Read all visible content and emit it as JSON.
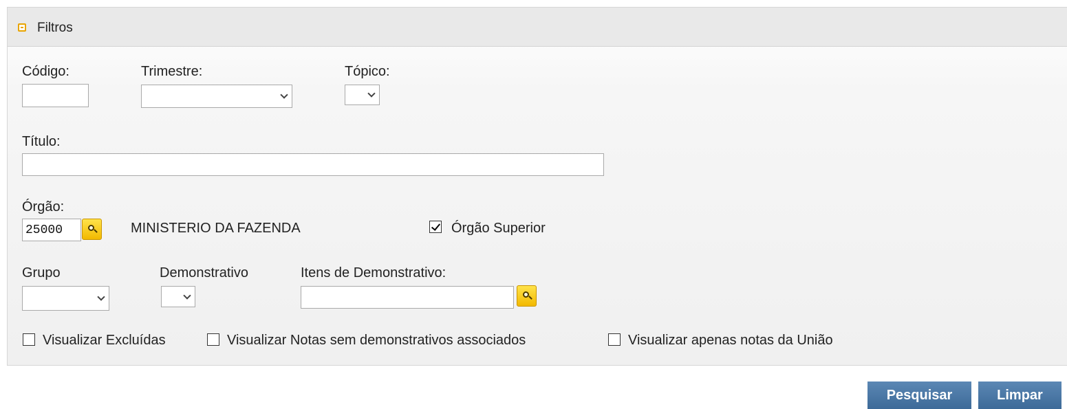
{
  "panel": {
    "title": "Filtros",
    "icon": "collapse-icon"
  },
  "fields": {
    "codigo": {
      "label": "Código:",
      "value": ""
    },
    "trimestre": {
      "label": "Trimestre:",
      "selected": ""
    },
    "topico": {
      "label": "Tópico:",
      "selected": ""
    },
    "titulo": {
      "label": "Título:",
      "value": ""
    },
    "orgao": {
      "label": "Órgão:",
      "value": "25000",
      "name": "MINISTERIO DA FAZENDA",
      "superior_label": "Órgão Superior",
      "superior_checked": true
    },
    "grupo": {
      "label": "Grupo",
      "selected": ""
    },
    "demonstrativo": {
      "label": "Demonstrativo",
      "selected": ""
    },
    "itens": {
      "label": "Itens de Demonstrativo:",
      "value": ""
    }
  },
  "options": [
    {
      "label": "Visualizar Excluídas",
      "checked": false
    },
    {
      "label": "Visualizar Notas sem demonstrativos associados",
      "checked": false
    },
    {
      "label": "Visualizar apenas notas da União",
      "checked": false
    }
  ],
  "actions": {
    "search_label": "Pesquisar",
    "clear_label": "Limpar"
  },
  "colors": {
    "accent_yellow": "#f2b900",
    "button_blue": "#4a76a4"
  }
}
